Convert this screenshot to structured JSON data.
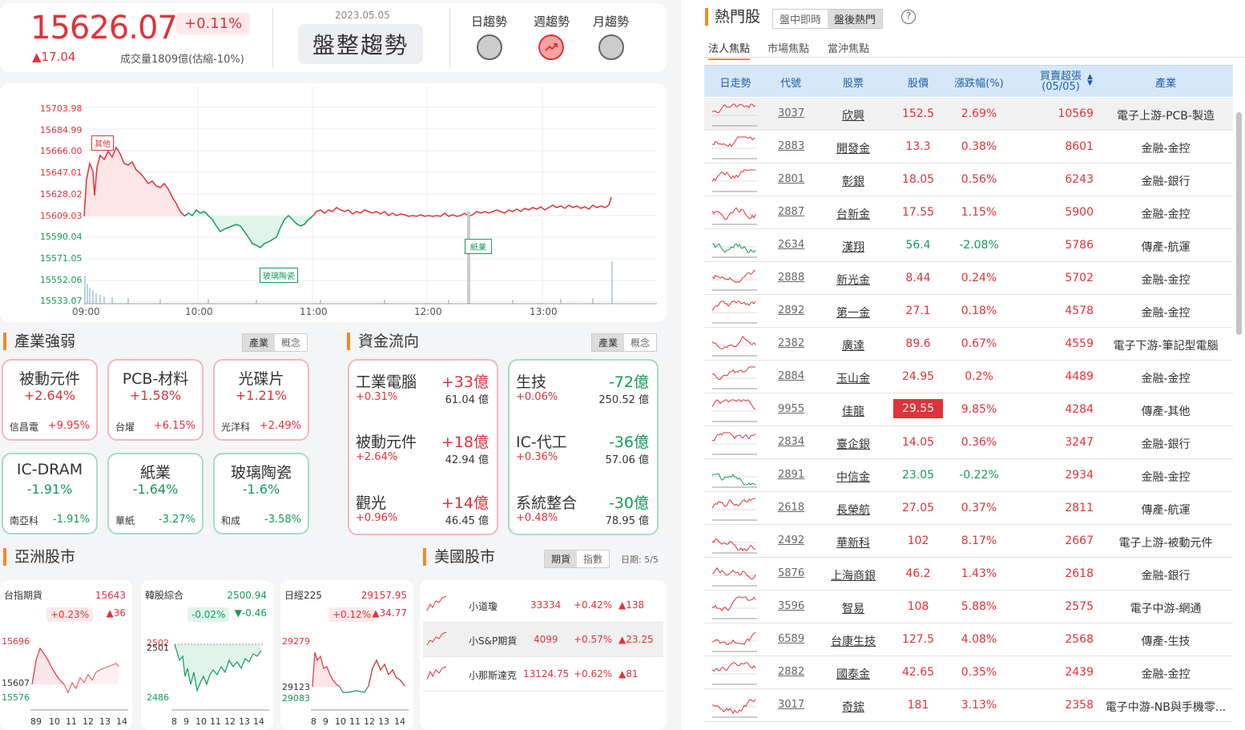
{
  "index": {
    "value": "15626.07",
    "pct": "+0.11%",
    "change": "▲17.04",
    "volume": "成交量1809億(估縮-10%)"
  },
  "trend": {
    "date": "2023.05.05",
    "label": "盤整趨勢",
    "day": "日趨勢",
    "week": "週趨勢",
    "month": "月趨勢"
  },
  "main_chart": {
    "y_labels": [
      "15703.98",
      "15684.99",
      "15666.00",
      "15647.01",
      "15628.02",
      "15609.03",
      "15590.04",
      "15571.05",
      "15552.06",
      "15533.07"
    ],
    "x_labels": [
      "09:00",
      "10:00",
      "11:00",
      "12:00",
      "13:00"
    ],
    "annotations": [
      "其他",
      "玻璃陶瓷",
      "紙業"
    ]
  },
  "sector": {
    "title": "產業強弱",
    "tab1": "產業",
    "tab2": "概念",
    "cards": [
      {
        "name": "被動元件",
        "pct": "+2.64%",
        "stock": "信昌電",
        "stock_pct": "+9.95%"
      },
      {
        "name": "PCB-材料",
        "pct": "+1.58%",
        "stock": "台燿",
        "stock_pct": "+6.15%"
      },
      {
        "name": "光碟片",
        "pct": "+1.21%",
        "stock": "光洋科",
        "stock_pct": "+2.49%"
      },
      {
        "name": "IC-DRAM",
        "pct": "-1.91%",
        "stock": "南亞科",
        "stock_pct": "-1.91%"
      },
      {
        "name": "紙業",
        "pct": "-1.64%",
        "stock": "華紙",
        "stock_pct": "-3.27%"
      },
      {
        "name": "玻璃陶瓷",
        "pct": "-1.6%",
        "stock": "和成",
        "stock_pct": "-3.58%"
      }
    ]
  },
  "flow": {
    "title": "資金流向",
    "tab1": "產業",
    "tab2": "概念",
    "in": [
      {
        "name": "工業電腦",
        "amt": "+33億",
        "pct": "+0.31%",
        "vol": "61.04 億"
      },
      {
        "name": "被動元件",
        "amt": "+18億",
        "pct": "+2.64%",
        "vol": "42.94 億"
      },
      {
        "name": "觀光",
        "amt": "+14億",
        "pct": "+0.96%",
        "vol": "46.45 億"
      }
    ],
    "out": [
      {
        "name": "生技",
        "amt": "-72億",
        "pct": "+0.06%",
        "vol": "250.52 億"
      },
      {
        "name": "IC-代工",
        "amt": "-36億",
        "pct": "+0.36%",
        "vol": "57.06 億"
      },
      {
        "name": "系統整合",
        "amt": "-30億",
        "pct": "+0.48%",
        "vol": "78.95 億"
      }
    ]
  },
  "asia": {
    "title": "亞洲股市",
    "cards": [
      {
        "name": "台指期貨",
        "value": "15643",
        "pct": "+0.23%",
        "chg": "▲36",
        "y_top": "15696",
        "y_mid": "15607",
        "y_bot": "15576",
        "x": [
          "89",
          "10",
          "11",
          "12",
          "13",
          "14"
        ]
      },
      {
        "name": "韓股綜合",
        "value": "2500.94",
        "pct": "-0.02%",
        "chg": "▼-0.46",
        "y_top": "2502",
        "y_top2": "2501",
        "y_bot": "2486",
        "x": [
          "8",
          "9",
          "10",
          "11",
          "12",
          "13",
          "14"
        ]
      },
      {
        "name": "日經225",
        "value": "29157.95",
        "pct": "+0.12%",
        "chg": "▲34.77",
        "y_top": "29279",
        "y_mid": "29123",
        "y_bot": "29083",
        "x": [
          "8",
          "9",
          "10",
          "11",
          "12",
          "13",
          "14"
        ]
      }
    ]
  },
  "us": {
    "title": "美國股市",
    "tab1": "期貨",
    "tab2": "指數",
    "date": "日期: 5/5",
    "rows": [
      {
        "name": "小道瓊",
        "value": "33334",
        "pct": "+0.42%",
        "chg": "▲138"
      },
      {
        "name": "小S&P期貨",
        "value": "4099",
        "pct": "+0.57%",
        "chg": "▲23.25"
      },
      {
        "name": "小那斯達克",
        "value": "13124.75",
        "pct": "+0.62%",
        "chg": "▲81"
      }
    ]
  },
  "hot": {
    "title": "熱門股",
    "tab1": "盤中即時",
    "tab2": "盤後熱門",
    "subtabs": [
      "法人焦點",
      "市場焦點",
      "當沖焦點"
    ],
    "headers": {
      "trend": "日走勢",
      "code": "代號",
      "name": "股票",
      "price": "股價",
      "pct": "漲跌幅(%)",
      "buy": "買賣超張",
      "buy_date": "(05/05)",
      "industry": "產業"
    },
    "rows": [
      {
        "code": "3037",
        "name": "欣興",
        "price": "152.5",
        "pct": "2.69%",
        "buy": "10569",
        "industry": "電子上游-PCB-製造",
        "up": true
      },
      {
        "code": "2883",
        "name": "開發金",
        "price": "13.3",
        "pct": "0.38%",
        "buy": "8601",
        "industry": "金融-金控",
        "up": true
      },
      {
        "code": "2801",
        "name": "彰銀",
        "price": "18.05",
        "pct": "0.56%",
        "buy": "6243",
        "industry": "金融-銀行",
        "up": true
      },
      {
        "code": "2887",
        "name": "台新金",
        "price": "17.55",
        "pct": "1.15%",
        "buy": "5900",
        "industry": "金融-金控",
        "up": true
      },
      {
        "code": "2634",
        "name": "漢翔",
        "price": "56.4",
        "pct": "-2.08%",
        "buy": "5786",
        "industry": "傳產-航運",
        "up": false
      },
      {
        "code": "2888",
        "name": "新光金",
        "price": "8.44",
        "pct": "0.24%",
        "buy": "5702",
        "industry": "金融-金控",
        "up": true
      },
      {
        "code": "2892",
        "name": "第一金",
        "price": "27.1",
        "pct": "0.18%",
        "buy": "4578",
        "industry": "金融-金控",
        "up": true
      },
      {
        "code": "2382",
        "name": "廣達",
        "price": "89.6",
        "pct": "0.67%",
        "buy": "4559",
        "industry": "電子下游-筆記型電腦",
        "up": true
      },
      {
        "code": "2884",
        "name": "玉山金",
        "price": "24.95",
        "pct": "0.2%",
        "buy": "4489",
        "industry": "金融-金控",
        "up": true
      },
      {
        "code": "9955",
        "name": "佳龍",
        "price": "29.55",
        "pct": "9.85%",
        "buy": "4284",
        "industry": "傳產-其他",
        "up": true,
        "limit": true
      },
      {
        "code": "2834",
        "name": "臺企銀",
        "price": "14.05",
        "pct": "0.36%",
        "buy": "3247",
        "industry": "金融-銀行",
        "up": true
      },
      {
        "code": "2891",
        "name": "中信金",
        "price": "23.05",
        "pct": "-0.22%",
        "buy": "2934",
        "industry": "金融-金控",
        "up": false
      },
      {
        "code": "2618",
        "name": "長榮航",
        "price": "27.05",
        "pct": "0.37%",
        "buy": "2811",
        "industry": "傳產-航運",
        "up": true
      },
      {
        "code": "2492",
        "name": "華新科",
        "price": "102",
        "pct": "8.17%",
        "buy": "2667",
        "industry": "電子上游-被動元件",
        "up": true
      },
      {
        "code": "5876",
        "name": "上海商銀",
        "price": "46.2",
        "pct": "1.43%",
        "buy": "2618",
        "industry": "金融-銀行",
        "up": true
      },
      {
        "code": "3596",
        "name": "智易",
        "price": "108",
        "pct": "5.88%",
        "buy": "2575",
        "industry": "電子中游-網通",
        "up": true
      },
      {
        "code": "6589",
        "name": "台康生技",
        "price": "127.5",
        "pct": "4.08%",
        "buy": "2568",
        "industry": "傳產-生技",
        "up": true
      },
      {
        "code": "2882",
        "name": "國泰金",
        "price": "42.65",
        "pct": "0.35%",
        "buy": "2439",
        "industry": "金融-金控",
        "up": true
      },
      {
        "code": "3017",
        "name": "奇鋐",
        "price": "181",
        "pct": "3.13%",
        "buy": "2358",
        "industry": "電子中游-NB與手機零...",
        "up": true
      }
    ]
  }
}
